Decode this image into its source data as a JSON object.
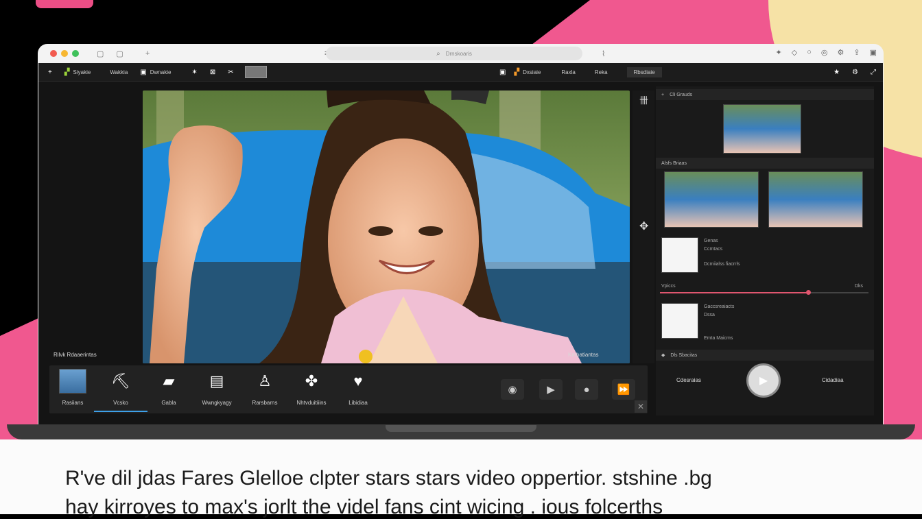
{
  "colors": {
    "accent": "#ec4e86",
    "pink_bg": "#f0588f",
    "cream": "#f6e2a6",
    "slider": "#e0566f",
    "underline": "#3ea0e8"
  },
  "browser": {
    "address": "Drnskoaris",
    "icons": [
      "sidebar-icon",
      "tab-icon",
      "plus-icon",
      "share-icon",
      "lock-icon",
      "star-icon",
      "shield-icon",
      "account-icon",
      "settings-icon"
    ]
  },
  "toolbar": {
    "items": [
      {
        "icon": "plus-icon",
        "label": ""
      },
      {
        "icon": "logo-icon",
        "label": "Siyakie"
      },
      {
        "icon": "",
        "label": "Wakkia"
      },
      {
        "icon": "box-icon",
        "label": "Dwnakie"
      }
    ],
    "mid": [
      {
        "icon": "box-icon",
        "label": ""
      },
      {
        "icon": "logo-icon",
        "label": "Dxsiaie"
      },
      {
        "icon": "",
        "label": "Raxla"
      },
      {
        "icon": "",
        "label": "Reka"
      }
    ],
    "active_tab": "Rbsdiaie"
  },
  "preview": {
    "caption_left": "Rilvk Rdaaerintas",
    "caption_right": "Kmbatiantas"
  },
  "tools": [
    {
      "label": "Rasiians",
      "glyph": "thumb"
    },
    {
      "label": "Vcsko",
      "glyph": "⛏"
    },
    {
      "label": "Gabla",
      "glyph": "📷"
    },
    {
      "label": "Wwngkyagy",
      "glyph": "▤"
    },
    {
      "label": "Rarsbarns",
      "glyph": "🔔"
    },
    {
      "label": "Nhtvduitiiins",
      "glyph": "✤"
    },
    {
      "label": "Libidiaa",
      "glyph": "♥"
    }
  ],
  "right_panel": {
    "h1": "Cli  Grauds",
    "h2": "Alsfs  Briaas",
    "item1_title": "Genas",
    "item1_sub": "Ccmtacs",
    "item1_meta": "Dcmiialss fiacrrls",
    "slider_left": "Vpiccs",
    "slider_right": "Dks",
    "slider_value": 0.71,
    "item2_title": "Gaccsreaiacts",
    "item2_sub": "Dssa",
    "item2_meta": "Emta Maicms",
    "h3": "Dls  Sbacitas",
    "left_label": "Cdesraias",
    "right_label": "Cidadiaa"
  },
  "bottom_text": {
    "line1": "R've dil jdas Fares Glelloe clpter stars stars video oppertior. stshine .bg",
    "line2": "hay kirroyes to max's jorlt the videl fans cint wicing . ious folcerths"
  }
}
